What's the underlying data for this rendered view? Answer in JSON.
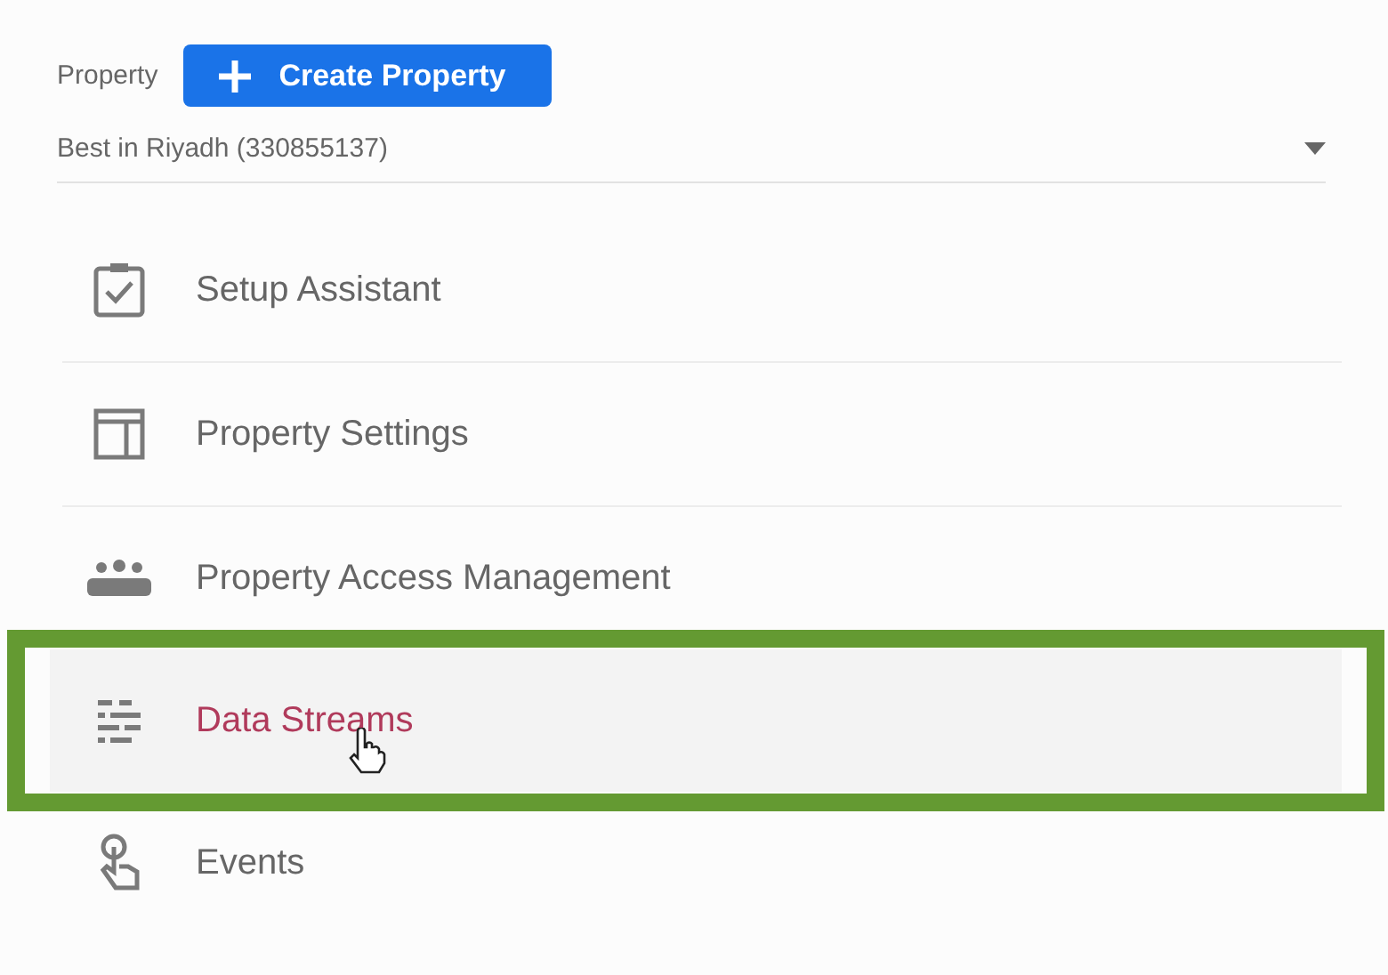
{
  "property": {
    "label": "Property",
    "create_button": "Create Property",
    "selector": {
      "value": "Best in Riyadh (330855137)"
    }
  },
  "menu": [
    {
      "label": "Setup Assistant",
      "selected": false,
      "highlighted": false
    },
    {
      "label": "Property Settings",
      "selected": false,
      "highlighted": false
    },
    {
      "label": "Property Access Management",
      "selected": false,
      "highlighted": false
    },
    {
      "label": "Data Streams",
      "selected": true,
      "highlighted": true
    },
    {
      "label": "Events",
      "selected": false,
      "highlighted": false
    }
  ]
}
